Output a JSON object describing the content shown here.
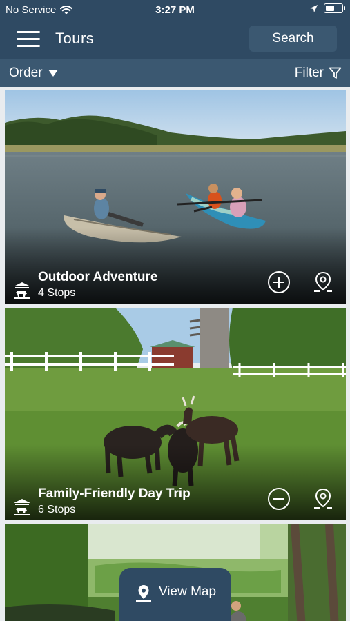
{
  "status": {
    "carrier": "No Service",
    "time": "3:27 PM",
    "battery_level": 0.55
  },
  "header": {
    "title": "Tours",
    "search_label": "Search"
  },
  "subheader": {
    "order_label": "Order",
    "filter_label": "Filter"
  },
  "tours": [
    {
      "title": "Outdoor Adventure",
      "stops": "4 Stops",
      "action_icon": "add-circle-icon"
    },
    {
      "title": "Family-Friendly Day Trip",
      "stops": "6 Stops",
      "action_icon": "remove-circle-icon"
    },
    {
      "title": "",
      "stops": ""
    }
  ],
  "map_button": {
    "label": "View Map"
  },
  "colors": {
    "primary": "#2f4a63",
    "secondary": "#3b5871"
  }
}
